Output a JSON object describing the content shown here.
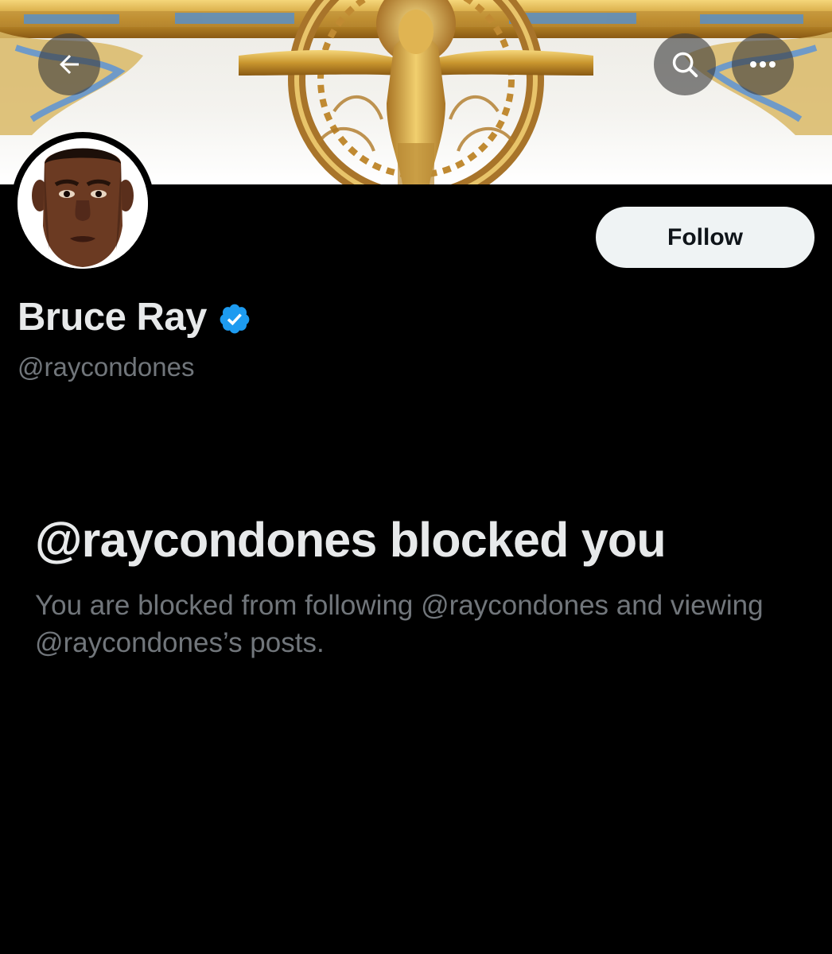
{
  "header": {
    "back_icon": "arrow-left-icon",
    "search_icon": "search-icon",
    "more_icon": "more-horizontal-icon",
    "banner_image": "golden-crucifix-banner"
  },
  "profile": {
    "avatar": "profile-avatar-photo",
    "display_name": "Bruce Ray",
    "verified_icon": "verified-badge-icon",
    "verified_color": "#1d9bf0",
    "handle": "@raycondones",
    "follow_label": "Follow"
  },
  "blocked": {
    "title": "@raycondones blocked you",
    "description": "You are blocked from following @raycondones and viewing @raycondones’s posts."
  },
  "colors": {
    "background": "#000000",
    "primary_text": "#e7e9ea",
    "secondary_text": "#71767b",
    "follow_button_bg": "#eff3f4"
  }
}
